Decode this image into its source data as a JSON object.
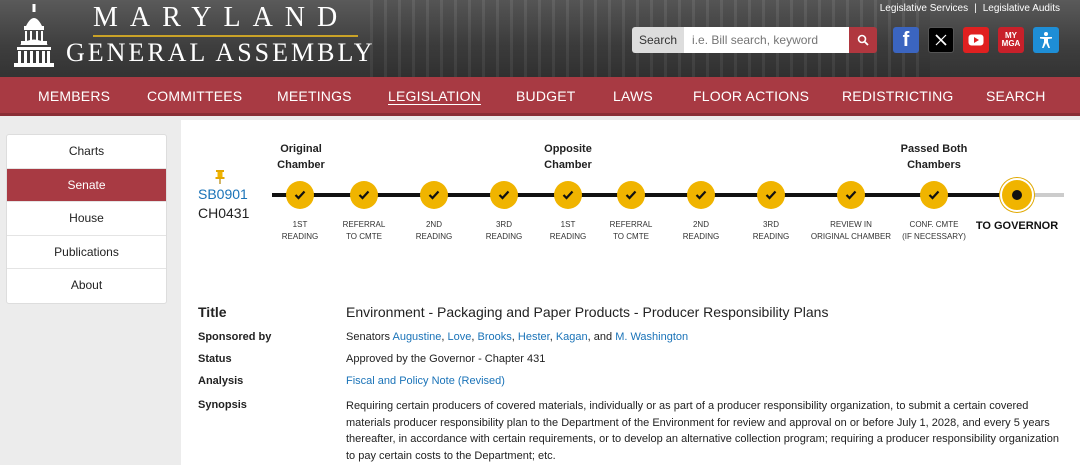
{
  "header": {
    "logo_line1": "MARYLAND",
    "logo_line2": "GENERAL ASSEMBLY",
    "top_links": [
      "Legislative Services",
      "Legislative Audits"
    ],
    "top_link_separator": "|",
    "search_label": "Search",
    "search_placeholder": "i.e. Bill search, keyword",
    "social_icons": [
      "facebook-icon",
      "x-icon",
      "youtube-icon",
      "mymga-icon",
      "accessibility-icon"
    ],
    "mymga_text": "MY MGA"
  },
  "nav": {
    "items": [
      "MEMBERS",
      "COMMITTEES",
      "MEETINGS",
      "LEGISLATION",
      "BUDGET",
      "LAWS",
      "FLOOR ACTIONS",
      "REDISTRICTING",
      "SEARCH"
    ],
    "active": "LEGISLATION"
  },
  "sidebar": {
    "items": [
      "Charts",
      "Senate",
      "House",
      "Publications",
      "About"
    ],
    "active": "Senate"
  },
  "bill": {
    "number": "SB0901",
    "chapter": "CH0431"
  },
  "tracker": {
    "headers": {
      "original": "Original Chamber",
      "opposite": "Opposite Chamber",
      "passed": "Passed Both Chambers"
    },
    "steps": [
      {
        "line1": "1ST",
        "line2": "READING"
      },
      {
        "line1": "REFERRAL",
        "line2": "TO CMTE"
      },
      {
        "line1": "2ND",
        "line2": "READING"
      },
      {
        "line1": "3RD",
        "line2": "READING"
      },
      {
        "line1": "1ST",
        "line2": "READING"
      },
      {
        "line1": "REFERRAL",
        "line2": "TO CMTE"
      },
      {
        "line1": "2ND",
        "line2": "READING"
      },
      {
        "line1": "3RD",
        "line2": "READING"
      },
      {
        "line1": "REVIEW IN",
        "line2": "ORIGINAL CHAMBER"
      },
      {
        "line1": "CONF. CMTE",
        "line2": "(IF NECESSARY)"
      }
    ],
    "final": "TO GOVERNOR",
    "colors": {
      "step": "#f0b400",
      "line": "#111111"
    }
  },
  "details": {
    "title_label": "Title",
    "title_value": "Environment - Packaging and Paper Products - Producer Responsibility Plans",
    "sponsor_label": "Sponsored by",
    "sponsor_prefix": "Senators",
    "sponsors": [
      "Augustine",
      "Love",
      "Brooks",
      "Hester",
      "Kagan"
    ],
    "sponsor_last": "M. Washington",
    "sponsor_and": "and",
    "status_label": "Status",
    "status_value": "Approved by the Governor - Chapter 431",
    "analysis_label": "Analysis",
    "analysis_value": "Fiscal and Policy Note (Revised)",
    "synopsis_label": "Synopsis",
    "synopsis_value": "Requiring certain producers of covered materials, individually or as part of a producer responsibility organization, to submit a certain covered materials producer responsibility plan to the Department of the Environment for review and approval on or before July 1, 2028, and every 5 years thereafter, in accordance with certain requirements, or to develop an alternative collection program; requiring a producer responsibility organization to pay certain costs to the Department; etc."
  },
  "colors": {
    "brand_red": "#a83a43",
    "link_blue": "#1a73b8",
    "gold": "#c9a227"
  }
}
